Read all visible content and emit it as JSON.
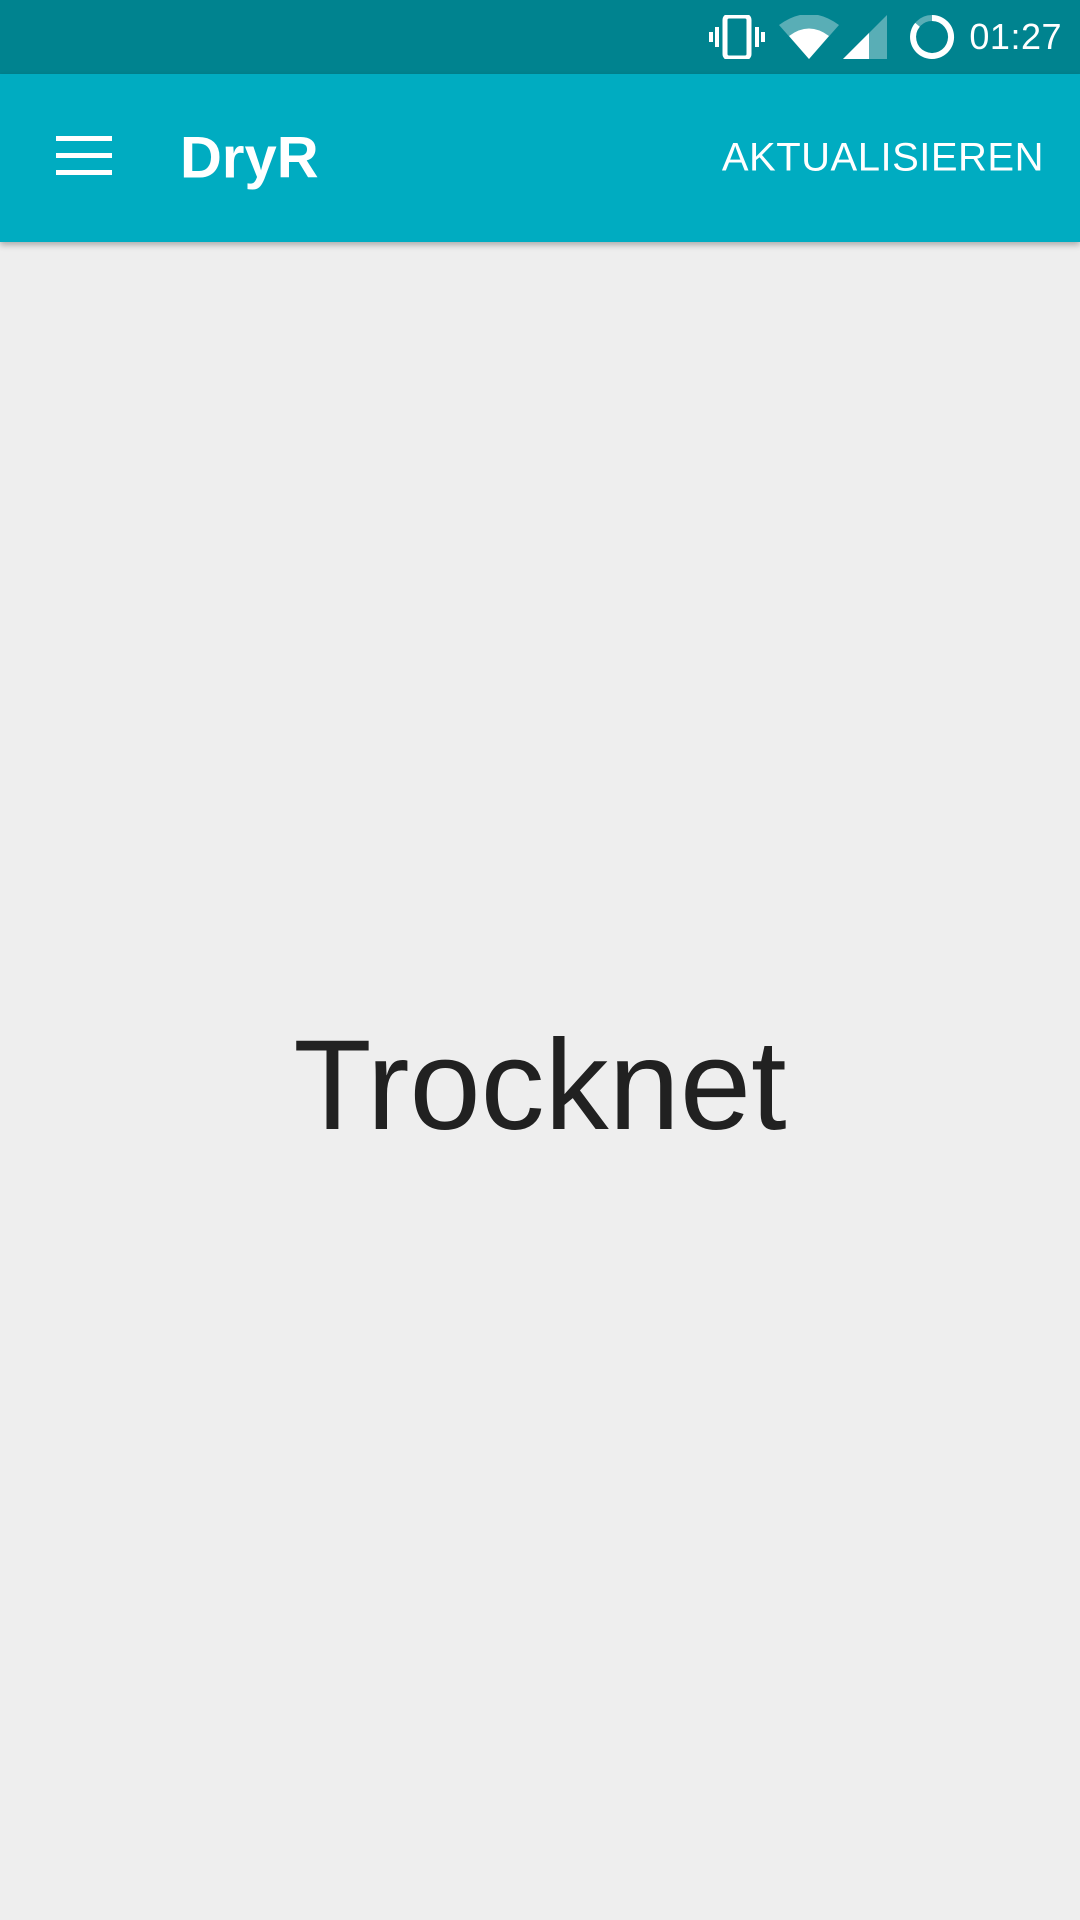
{
  "status_bar": {
    "time": "01:27",
    "icons": [
      "vibrate-icon",
      "wifi-icon",
      "signal-icon",
      "battery-icon"
    ],
    "color": "#00838F"
  },
  "app_bar": {
    "menu_icon": "menu-icon",
    "title": "DryR",
    "action_label": "AKTUALISIEREN",
    "color": "#00ACC1"
  },
  "main": {
    "status_text": "Trocknet",
    "background": "#EEEEEE"
  }
}
